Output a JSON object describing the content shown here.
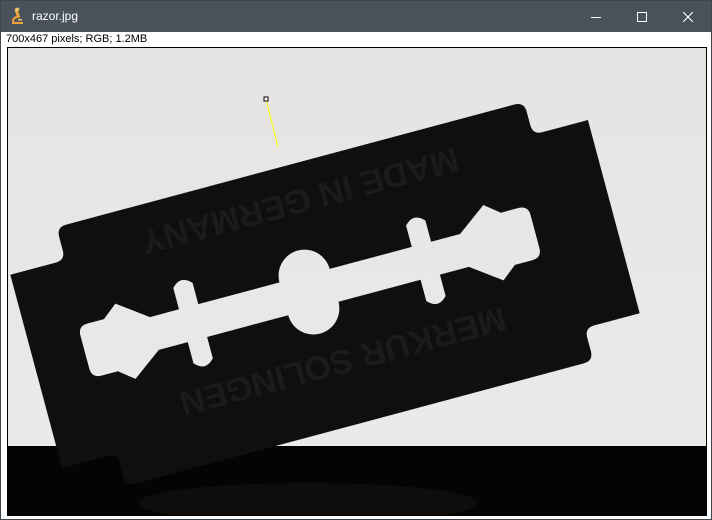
{
  "window": {
    "title": "razor.jpg",
    "app_icon": "microscope-icon",
    "controls": {
      "minimize_icon": "minimize-icon",
      "maximize_icon": "maximize-icon",
      "close_icon": "close-icon"
    }
  },
  "image_info": "700x467 pixels; RGB; 1.2MB",
  "image": {
    "subject": "razor-blade-silhouette",
    "background_color": "#e6e4e2",
    "blade_color": "#110e0e",
    "table_color": "#050404",
    "selection_color": "#ffff00"
  }
}
